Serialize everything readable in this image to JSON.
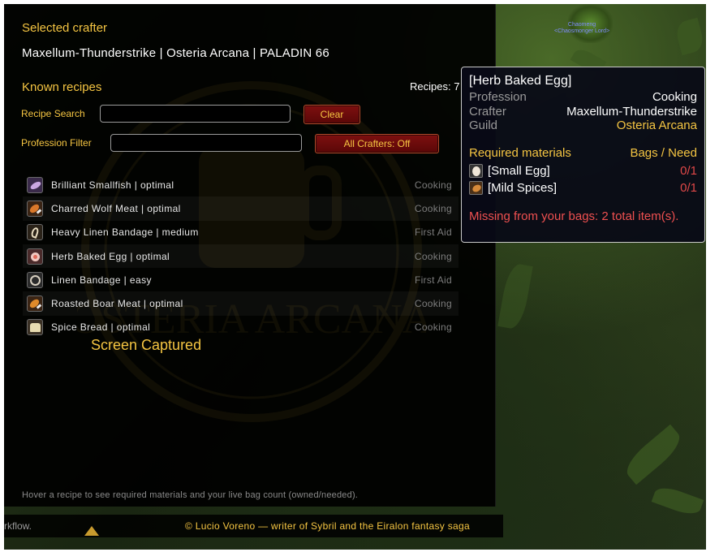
{
  "panel": {
    "selected_crafter_title": "Selected crafter",
    "crafter_line": "Maxellum-Thunderstrike | Osteria Arcana | PALADIN 66",
    "known_recipes_title": "Known recipes",
    "recipes_count": "Recipes: 7",
    "recipe_search_label": "Recipe Search",
    "recipe_search_value": "",
    "clear_button": "Clear",
    "profession_filter_label": "Profession Filter",
    "profession_filter_value": "",
    "all_crafters_button": "All Crafters: Off",
    "watermark_text": "OSTERIA ARCANA",
    "screen_captured": "Screen Captured",
    "hint": "Hover a recipe to see required materials and your live bag count (owned/needed)."
  },
  "recipes": [
    {
      "name": "Brilliant Smallfish  |  optimal",
      "profession": "Cooking",
      "icon": "fish-icon"
    },
    {
      "name": "Charred Wolf Meat  |  optimal",
      "profession": "Cooking",
      "icon": "meat-leg-icon"
    },
    {
      "name": "Heavy Linen Bandage  |  medium",
      "profession": "First Aid",
      "icon": "bandage-icon"
    },
    {
      "name": "Herb Baked Egg  |  optimal",
      "profession": "Cooking",
      "icon": "egg-icon"
    },
    {
      "name": "Linen Bandage  |  easy",
      "profession": "First Aid",
      "icon": "bandage-roll-icon"
    },
    {
      "name": "Roasted Boar Meat  |  optimal",
      "profession": "Cooking",
      "icon": "meat-leg-icon"
    },
    {
      "name": "Spice Bread  |  optimal",
      "profession": "Cooking",
      "icon": "bread-icon"
    }
  ],
  "tooltip": {
    "title": "[Herb Baked Egg]",
    "profession_label": "Profession",
    "profession_value": "Cooking",
    "crafter_label": "Crafter",
    "crafter_value": "Maxellum-Thunderstrike",
    "guild_label": "Guild",
    "guild_value": "Osteria Arcana",
    "required_header": "Required materials",
    "bags_header": "Bags / Need",
    "materials": [
      {
        "name": "[Small Egg]",
        "count": "0/1",
        "icon": "egg-icon"
      },
      {
        "name": "[Mild Spices]",
        "count": "0/1",
        "icon": "spices-icon"
      }
    ],
    "missing": "Missing from your bags: 2 total item(s)."
  },
  "footer": {
    "workflow_fragment": "rkflow.",
    "copyright": "© Lucio Voreno — writer of Sybril and the Eiralon fantasy saga"
  },
  "world": {
    "nameplate_name": "Chaomeng",
    "nameplate_guild": "<Chaosmonger Lord>"
  },
  "colors": {
    "gold": "#f5c542",
    "missing_red": "#ef5050",
    "button_red": "#7e1010"
  }
}
